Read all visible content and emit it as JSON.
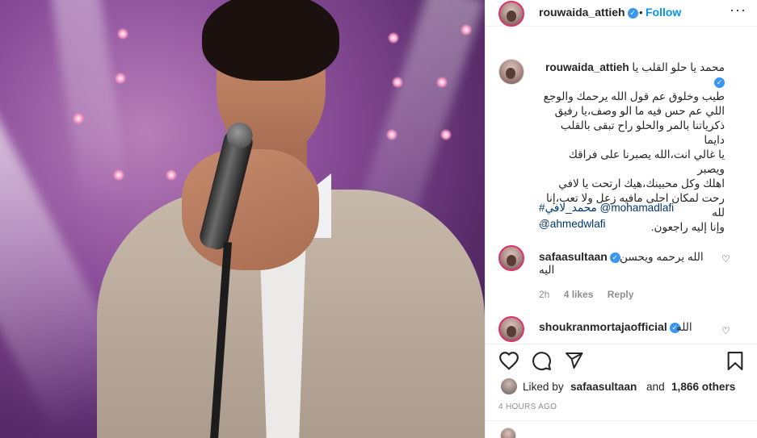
{
  "post": {
    "author": "rouwaida_attieh",
    "follow_label": "Follow",
    "separator": "•",
    "more_label": "···",
    "caption_lines": [
      "محمد يا حلو القلب يا",
      "طيب وخلوق عم قول الله يرحمك والوجع",
      "اللي عم حس فيه ما الو وصف،يا رفيق",
      "ذكرياتنا بالمر والحلو راح تبقى بالقلب دايما",
      "يا غالي انت،الله يصبرنا على فراقك ويصبر",
      "اهلك وكل محبينك،هيك ارتحت يا لافي",
      "رحت لمكان احلى مافيه زعل ولا تعب،إنا لله",
      "وإنا إليه راجعون."
    ],
    "caption_tag_1": "#محمد_لافي",
    "caption_mention_1": "@mohamadlafi",
    "caption_mention_2": "@ahmedwlafi",
    "caption_time": "4h"
  },
  "comments": [
    {
      "user": "safaasultaan",
      "text_line_1": "الله يرحمه ويحسن",
      "text_line_2": "اليه",
      "time": "2h",
      "likes": "4 likes",
      "reply": "Reply"
    },
    {
      "user": "shoukranmortajaofficial",
      "text_line_1": "الله"
    }
  ],
  "likes_summary": {
    "prefix": "Liked by ",
    "user": "safaasultaan",
    "middle": " and ",
    "count": "1,866 others"
  },
  "timestamp": "4 HOURS AGO",
  "icons": [
    "heart-icon",
    "comment-icon",
    "share-icon",
    "bookmark-icon",
    "verified-icon",
    "more-icon"
  ],
  "colors": {
    "follow": "#0095f6",
    "verified": "#3897f0",
    "link": "#00376b",
    "muted": "#8e8e8e"
  }
}
